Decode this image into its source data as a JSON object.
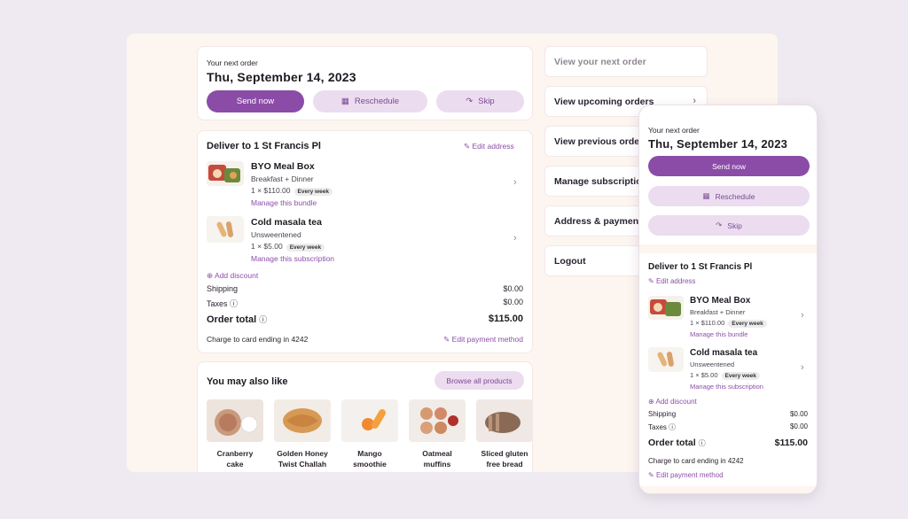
{
  "next_order": {
    "label": "Your next order",
    "date": "Thu, September 14, 2023",
    "send_now": "Send now",
    "reschedule": "Reschedule",
    "skip": "Skip"
  },
  "delivery": {
    "title": "Deliver to 1 St Francis Pl",
    "edit_address": "Edit address",
    "items": [
      {
        "name": "BYO Meal Box",
        "desc": "Breakfast + Dinner",
        "price": "1 × $110.00",
        "badge": "Every week",
        "link": "Manage this bundle"
      },
      {
        "name": "Cold masala tea",
        "desc": "Unsweentened",
        "price": "1 × $5.00",
        "badge": "Every week",
        "link": "Manage this subscription"
      }
    ],
    "add_discount": "Add discount",
    "shipping_label": "Shipping",
    "shipping_value": "$0.00",
    "taxes_label": "Taxes",
    "taxes_value": "$0.00",
    "total_label": "Order total",
    "total_value": "$115.00",
    "card_text": "Charge to card ending in 4242",
    "edit_payment": "Edit payment method"
  },
  "recommend": {
    "title": "You may also like",
    "browse": "Browse all products",
    "products": [
      {
        "line1": "Cranberry",
        "line2": "cake"
      },
      {
        "line1": "Golden Honey",
        "line2": "Twist Challah"
      },
      {
        "line1": "Mango",
        "line2": "smoothie"
      },
      {
        "line1": "Oatmeal",
        "line2": "muffins"
      },
      {
        "line1": "Sliced gluten",
        "line2": "free bread"
      }
    ]
  },
  "nav": {
    "items": [
      "View your next order",
      "View upcoming orders",
      "View previous orders",
      "Manage subscriptions",
      "Address & payment",
      "Logout"
    ]
  },
  "colors": {
    "accent": "#8b4ca8",
    "accent_light": "#ecdcf0",
    "bg": "#efeaf1",
    "panel": "#fdf5f0"
  }
}
